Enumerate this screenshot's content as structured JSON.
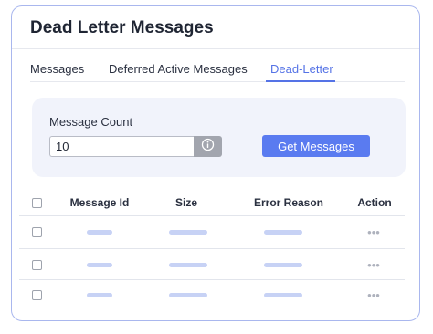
{
  "card": {
    "title": "Dead Letter Messages"
  },
  "tabs": [
    {
      "label": "Messages",
      "active": false
    },
    {
      "label": "Deferred Active Messages",
      "active": false
    },
    {
      "label": "Dead-Letter",
      "active": true
    }
  ],
  "form": {
    "message_count_label": "Message Count",
    "message_count_value": "10",
    "info_icon": "info-icon",
    "get_messages_label": "Get Messages"
  },
  "table": {
    "columns": [
      "Message Id",
      "Size",
      "Error Reason",
      "Action"
    ],
    "rows": [
      {
        "message_id": "",
        "size": "",
        "error_reason": "",
        "action": "more-options"
      },
      {
        "message_id": "",
        "size": "",
        "error_reason": "",
        "action": "more-options"
      },
      {
        "message_id": "",
        "size": "",
        "error_reason": "",
        "action": "more-options"
      }
    ],
    "action_glyph": "•••"
  },
  "colors": {
    "accent": "#5573e6",
    "button": "#5a7bf0",
    "card_border": "#a9b7ee",
    "panel_bg": "#f1f3fb",
    "placeholder_bar": "#c7d2f5"
  }
}
